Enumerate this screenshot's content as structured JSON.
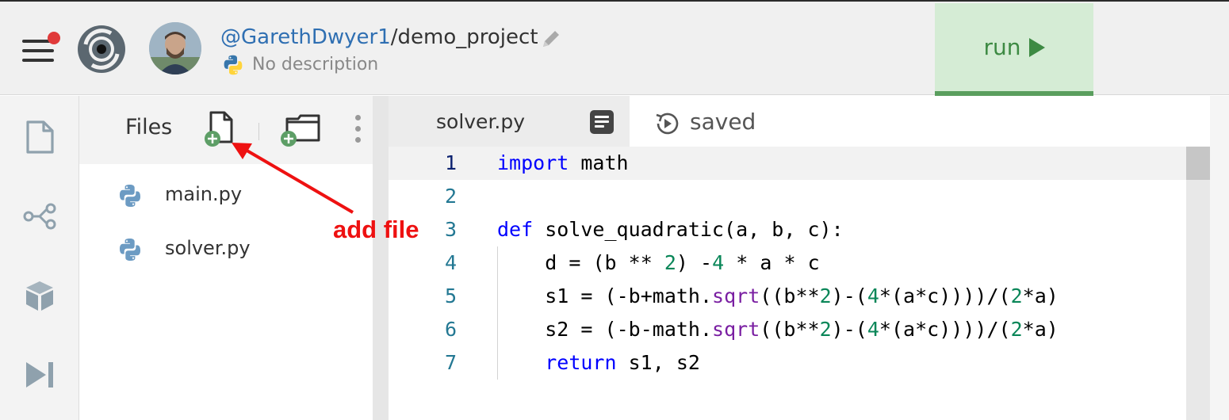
{
  "header": {
    "username": "@GarethDwyer1",
    "project_path": "/demo_project",
    "description": "No description",
    "run_label": "run"
  },
  "sidebar": {
    "items": [
      {
        "name": "files-icon"
      },
      {
        "name": "version-control-icon"
      },
      {
        "name": "packages-icon"
      },
      {
        "name": "debugger-icon"
      }
    ]
  },
  "files_panel": {
    "title": "Files",
    "files": [
      {
        "name": "main.py"
      },
      {
        "name": "solver.py"
      }
    ]
  },
  "editor": {
    "tab_filename": "solver.py",
    "status": "saved",
    "active_line": 1,
    "lines": [
      {
        "number": "1",
        "text": "import math"
      },
      {
        "number": "2",
        "text": ""
      },
      {
        "number": "3",
        "text": "def solve_quadratic(a, b, c):"
      },
      {
        "number": "4",
        "text": "    d = (b ** 2) -4 * a * c"
      },
      {
        "number": "5",
        "text": "    s1 = (-b+math.sqrt((b**2)-(4*(a*c))))/(2*a)"
      },
      {
        "number": "6",
        "text": "    s2 = (-b-math.sqrt((b**2)-(4*(a*c))))/(2*a)"
      },
      {
        "number": "7",
        "text": "    return s1, s2"
      }
    ]
  },
  "annotation": {
    "label": "add file",
    "color": "#ee1111"
  },
  "colors": {
    "run_background": "#d5ecd5",
    "run_accent": "#3d8a43",
    "link_blue": "#2f6fb2",
    "keyword": "#0000ff",
    "number": "#098658",
    "function": "#7a1fa2"
  }
}
